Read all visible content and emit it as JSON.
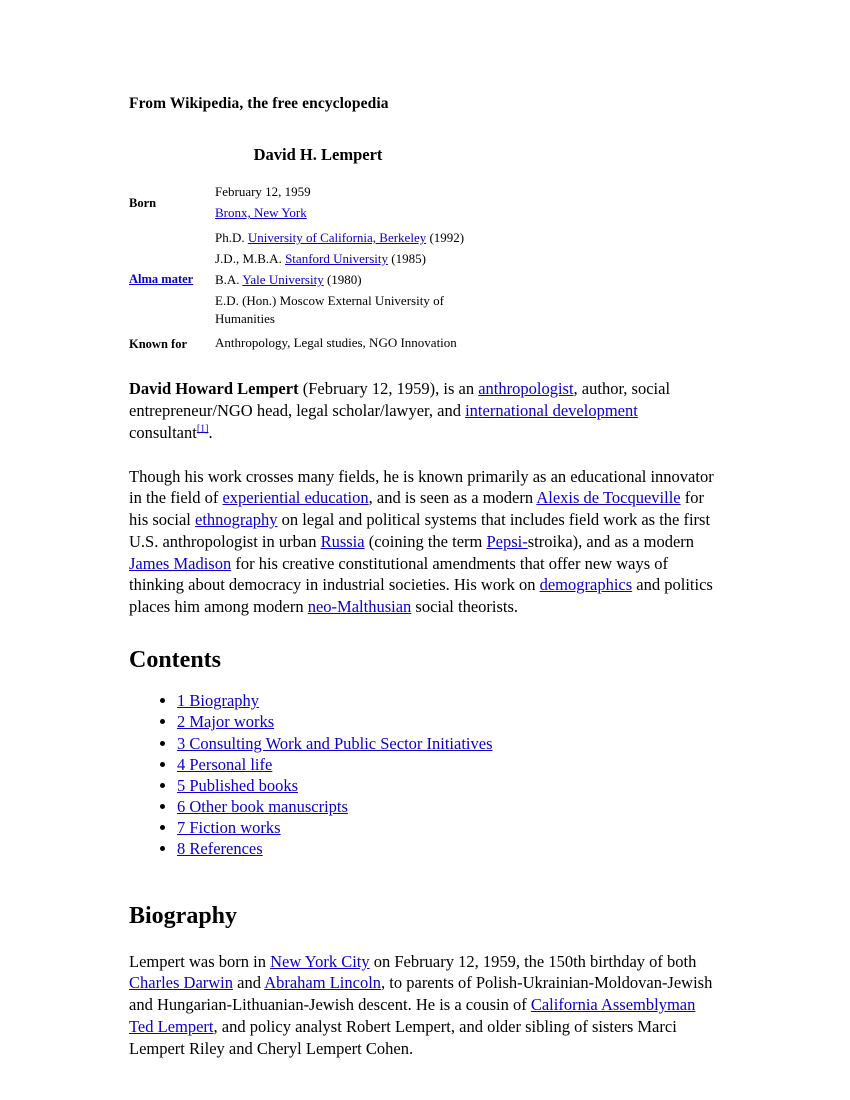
{
  "tagline": "From Wikipedia, the free encyclopedia",
  "infobox": {
    "title": "David H. Lempert",
    "born_label": "Born",
    "born_date": "February 12, 1959",
    "born_place": "Bronx, New York",
    "alma_mater_label": "Alma mater",
    "alma_mater": [
      {
        "prefix": "Ph.D. ",
        "link": "University of California, Berkeley",
        "suffix": " (1992)"
      },
      {
        "prefix": "J.D., M.B.A. ",
        "link": "Stanford University",
        "suffix": " (1985)"
      },
      {
        "prefix": "B.A. ",
        "link": "Yale University",
        "suffix": " (1980)"
      },
      {
        "prefix": "E.D. (Hon.) Moscow External University of Humanities",
        "link": "",
        "suffix": ""
      }
    ],
    "known_for_label": "Known for",
    "known_for": "Anthropology, Legal studies, NGO Innovation"
  },
  "lead": {
    "name": "David Howard Lempert",
    "t1": " (February 12, 1959), is an ",
    "l1": "anthropologist",
    "t2": ", author, social entrepreneur/NGO head, legal scholar/lawyer, and ",
    "l2": "international development",
    "t3": " consultant",
    "ref1": "[1]",
    "t4": "."
  },
  "paragraph2": {
    "t1": "Though his work crosses many fields, he is known primarily as an educational innovator in the field of ",
    "l1": "experiential education",
    "t2": ", and is seen as a modern ",
    "l2": "Alexis de Tocqueville",
    "t3": " for his social ",
    "l3": "ethnography",
    "t4": " on legal and political systems that includes field work as the first U.S. anthropologist in urban ",
    "l4": "Russia",
    "t5": " (coining the term ",
    "l5": "Pepsi-",
    "t6": "stroika), and as a modern ",
    "l6": "James Madison",
    "t7": " for his creative constitutional amendments that offer new ways of thinking about democracy in industrial societies. His work on ",
    "l7": "demographics",
    "t8": " and politics places him among modern ",
    "l8": "neo-Malthusian",
    "t9": " social theorists."
  },
  "contents": {
    "heading": "Contents",
    "items": [
      "1 Biography",
      "2 Major works",
      "3 Consulting Work and Public Sector Initiatives",
      "4 Personal life",
      "5 Published books",
      "6 Other book manuscripts",
      "7 Fiction works",
      "8 References"
    ]
  },
  "biography": {
    "heading": "Biography",
    "t1": "Lempert was born in ",
    "l1": "New York City",
    "t2": " on February 12, 1959, the 150th birthday of both ",
    "l2": "Charles Darwin",
    "t3": " and ",
    "l3": "Abraham Lincoln",
    "t4": ", to parents of Polish-Ukrainian-Moldovan-Jewish and Hungarian-Lithuanian-Jewish descent. He is a cousin of ",
    "l4": "California Assemblyman",
    "t5": " ",
    "l5": "Ted Lempert",
    "t6": ", and policy analyst Robert Lempert, and older sibling of sisters Marci Lempert Riley and Cheryl Lempert Cohen."
  },
  "colors": {
    "link": "#0b00cc",
    "text": "#000000",
    "background": "#ffffff"
  }
}
